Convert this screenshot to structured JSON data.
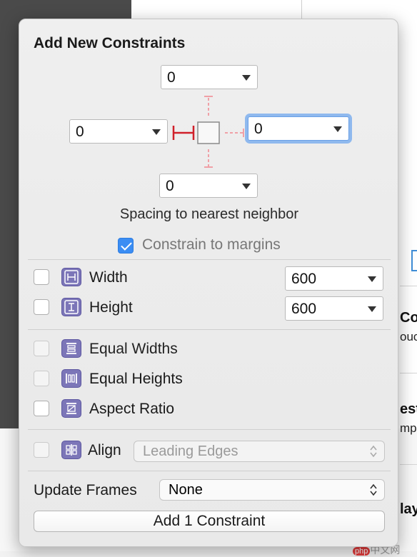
{
  "background": {
    "right_labels": [
      "Coo",
      "ouc",
      "est",
      "mpl",
      "lay"
    ],
    "watermark_badge": "php",
    "watermark_text": "中文网"
  },
  "popover": {
    "title": "Add New Constraints",
    "spacing": {
      "top": "0",
      "left": "0",
      "right": "0",
      "bottom": "0",
      "caption": "Spacing to nearest neighbor"
    },
    "constrain_to_margins": {
      "label": "Constrain to margins",
      "checked": true
    },
    "size_rows": [
      {
        "label": "Width",
        "value": "600",
        "icon": "width-icon"
      },
      {
        "label": "Height",
        "value": "600",
        "icon": "height-icon"
      }
    ],
    "equal_rows": [
      {
        "label": "Equal Widths",
        "icon": "equal-widths-icon"
      },
      {
        "label": "Equal Heights",
        "icon": "equal-heights-icon"
      },
      {
        "label": "Aspect Ratio",
        "icon": "aspect-ratio-icon"
      }
    ],
    "align": {
      "label": "Align",
      "value": "Leading Edges",
      "icon": "align-icon"
    },
    "update_frames": {
      "label": "Update Frames",
      "value": "None"
    },
    "add_button": "Add 1 Constraint"
  },
  "colors": {
    "accent": "#3b8df3",
    "pin_active": "#d0202a",
    "pin_inactive": "#f0a0a6",
    "icon_purple": "#7c76b8"
  }
}
